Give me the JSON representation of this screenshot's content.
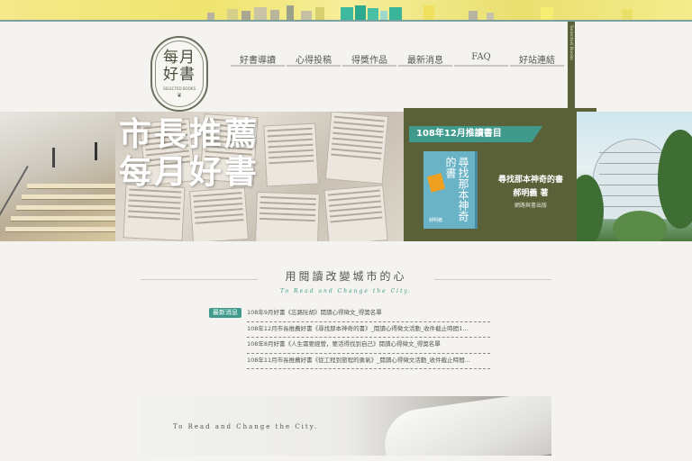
{
  "logo": {
    "text": "每月好書",
    "subtitle": "SELECTED BOOKS"
  },
  "nav": {
    "items": [
      {
        "label": "好書導讀"
      },
      {
        "label": "心得投稿"
      },
      {
        "label": "得獎作品"
      },
      {
        "label": "最新消息"
      },
      {
        "label": "FAQ"
      },
      {
        "label": "好站連結"
      }
    ]
  },
  "sidebar_tag": "Selected Books",
  "banner": {
    "title_line1": "市長推薦",
    "title_line2": "每月好書",
    "month_label": "108年12月推讀書目",
    "book": {
      "cover_title": "尋找那本神奇的書",
      "cover_author": "郝明義",
      "title": "尋找那本神奇的書",
      "author": "郝明義 著",
      "publisher": "網路與書出版"
    }
  },
  "slogan": {
    "zh": "用閱讀改變城市的心",
    "en": "To Read and Change the City."
  },
  "news": {
    "badge": "最新消息",
    "items": [
      {
        "text": "108年9月好書《忘路阮胡》閱讀心得徵文_得獎名單"
      },
      {
        "text": "108年12月市長推薦好書《尋找那本神奇的書》_閱讀心得徵文活動_收件截止時間1..."
      },
      {
        "text": "108年8月好書《人生需要經營，要活得找到自己》閱讀心得徵文_得獎名單"
      },
      {
        "text": "108年11月市長推薦好書《從工程到旅程的勇氣》_閱讀心得徵文活動_收件截止時間..."
      }
    ]
  },
  "bottom_banner": {
    "text": "To Read and Change the City."
  },
  "colors": {
    "olive": "#5a6038",
    "teal": "#3f9a8c",
    "background": "#f4f3ef",
    "strip_yellow": "#efe46e"
  }
}
